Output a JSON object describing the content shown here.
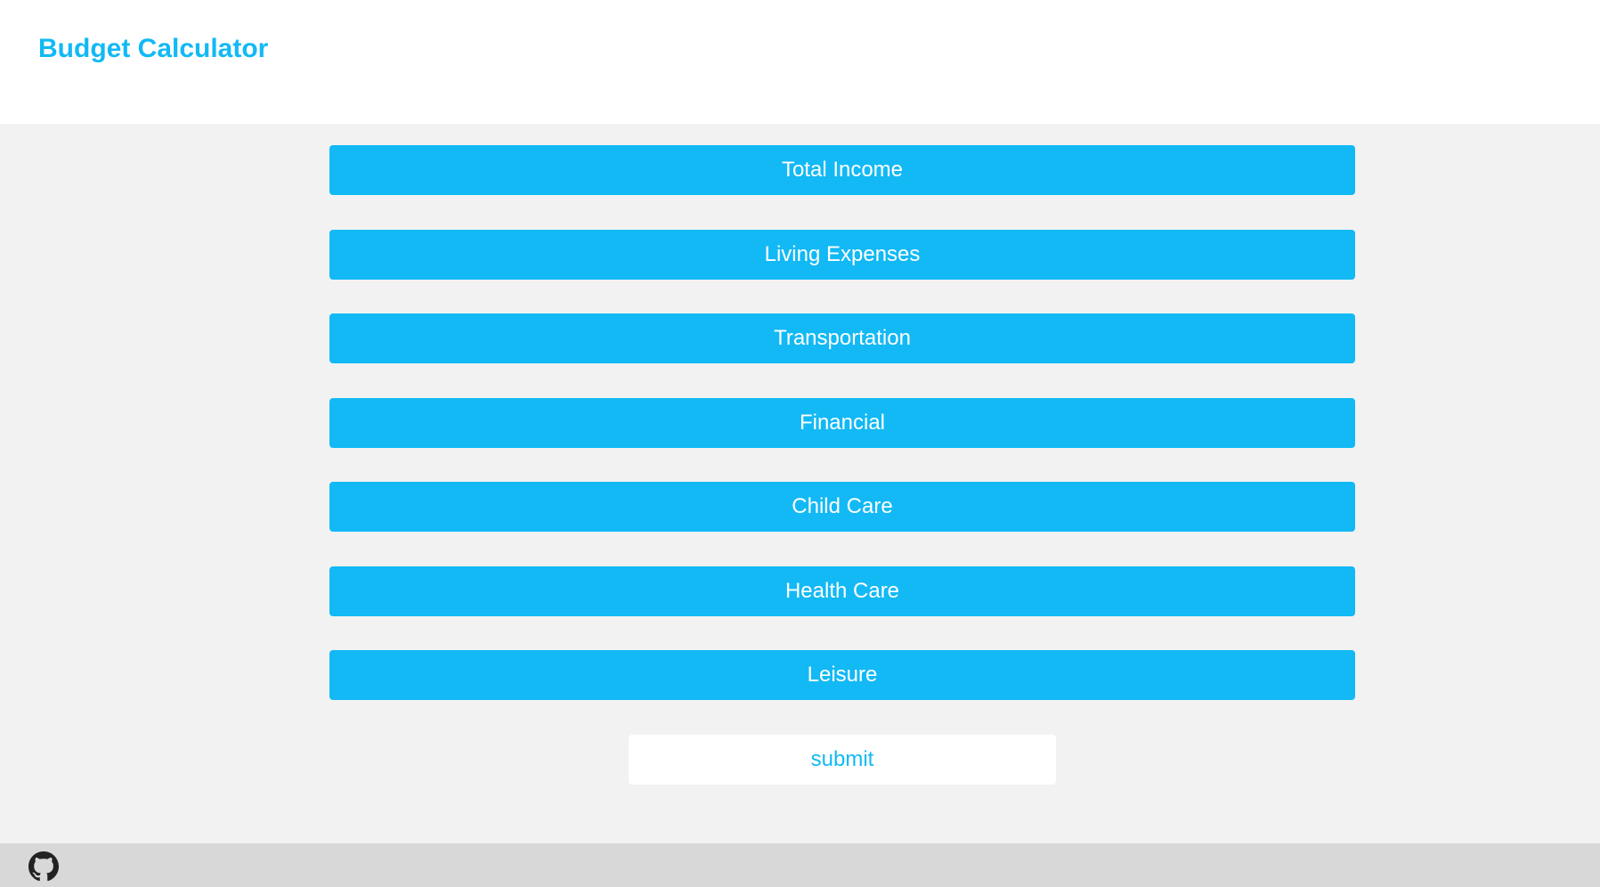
{
  "header": {
    "title": "Budget Calculator"
  },
  "categories": [
    {
      "label": "Total Income"
    },
    {
      "label": "Living Expenses"
    },
    {
      "label": "Transportation"
    },
    {
      "label": "Financial"
    },
    {
      "label": "Child Care"
    },
    {
      "label": "Health Care"
    },
    {
      "label": "Leisure"
    }
  ],
  "submit": {
    "label": "submit"
  },
  "footer": {
    "icon": "github-icon"
  },
  "colors": {
    "accent": "#12b9f5",
    "header_bg": "#ffffff",
    "main_bg": "#f2f2f2",
    "footer_bg": "#d8d8d8",
    "button_text": "#ffffff"
  }
}
